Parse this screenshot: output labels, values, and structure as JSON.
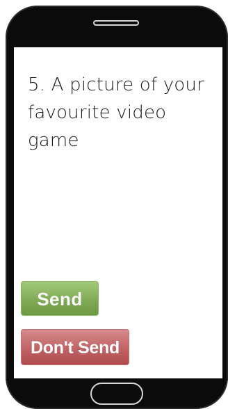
{
  "question": {
    "text": "5. A picture of your favourite video game"
  },
  "buttons": {
    "send_label": "Send",
    "dont_send_label": "Don't Send"
  },
  "colors": {
    "phone_body": "#0b0b0b",
    "send_green": "#7ea853",
    "dont_send_red": "#bf5f61"
  }
}
